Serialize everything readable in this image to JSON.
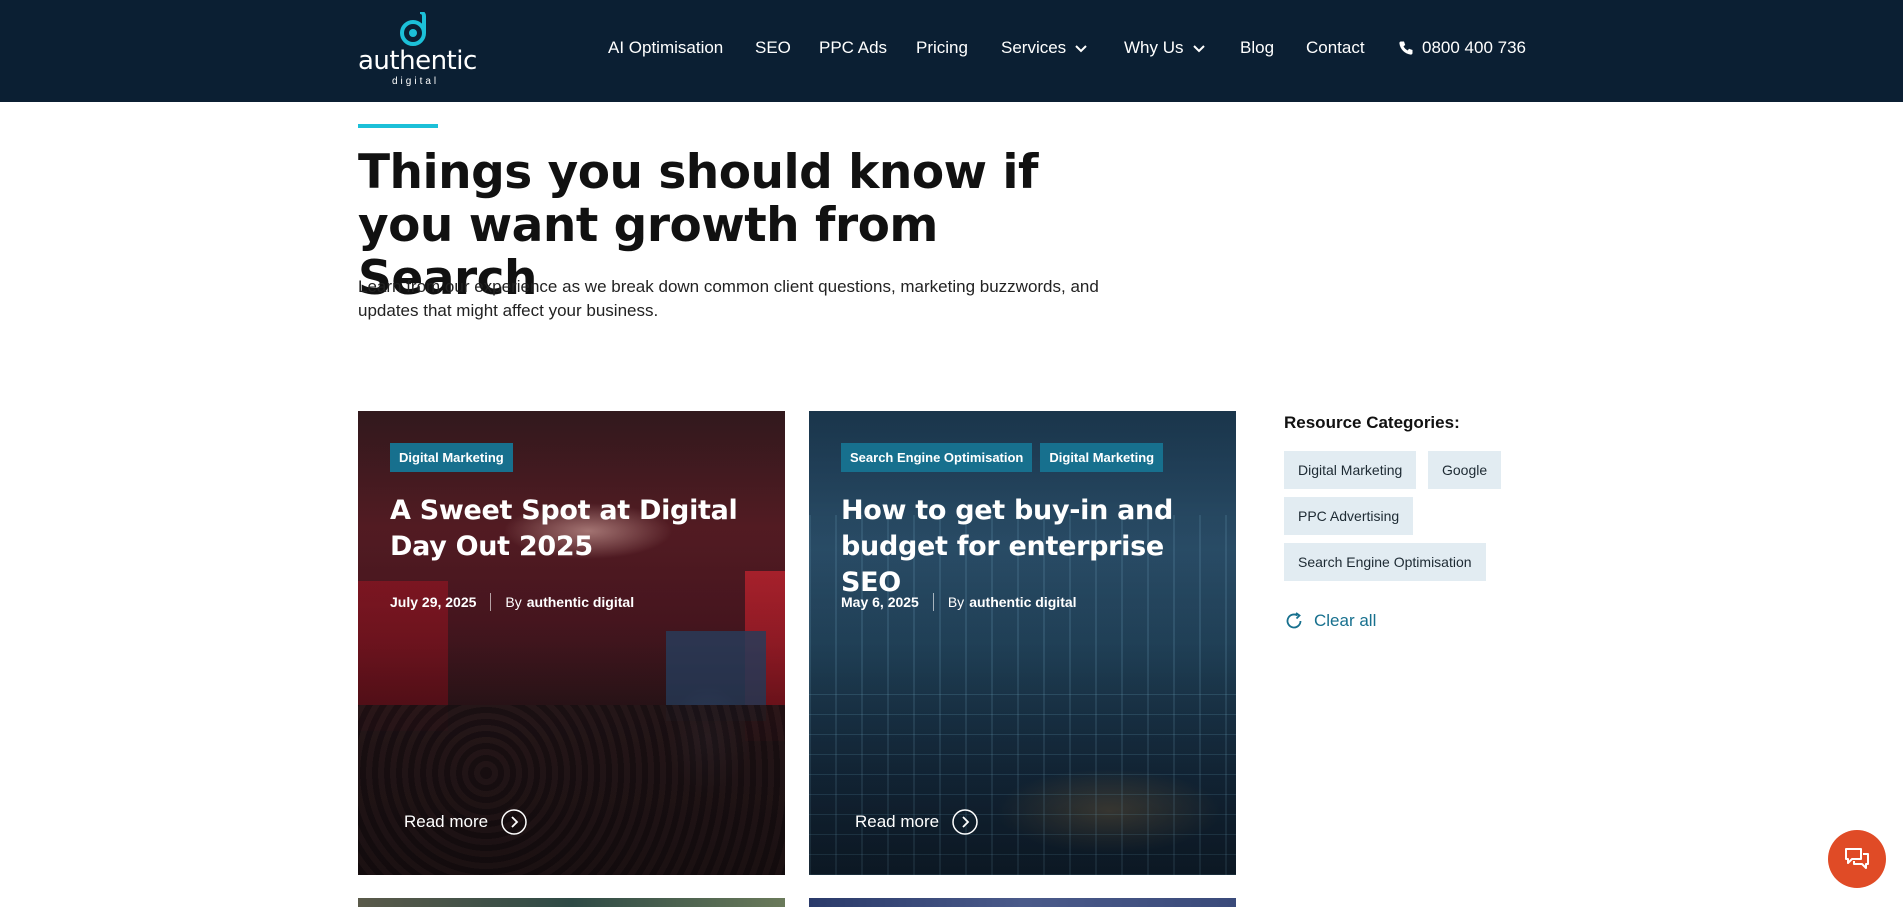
{
  "header": {
    "logo": {
      "word": "authentic",
      "sub": "digital"
    },
    "nav": [
      {
        "label": "AI Optimisation"
      },
      {
        "label": "SEO"
      },
      {
        "label": "PPC Ads"
      },
      {
        "label": "Pricing"
      },
      {
        "label": "Services",
        "dropdown": true
      },
      {
        "label": "Why Us",
        "dropdown": true
      },
      {
        "label": "Blog"
      },
      {
        "label": "Contact"
      }
    ],
    "phone": "0800 400 736"
  },
  "hero": {
    "title": "Things you should know if you want growth from Search",
    "subtitle": "Learn from our experience as we break down common client questions, marketing buzzwords, and updates that might affect your business."
  },
  "cards": [
    {
      "tags": [
        "Digital Marketing"
      ],
      "title": "A Sweet Spot at Digital Day Out 2025",
      "date": "July 29, 2025",
      "by": "By",
      "author": "authentic digital",
      "read_more": "Read more"
    },
    {
      "tags": [
        "Search Engine Optimisation",
        "Digital Marketing"
      ],
      "title": "How to get buy-in and budget for enterprise SEO",
      "date": "May 6, 2025",
      "by": "By",
      "author": "authentic digital",
      "read_more": "Read more"
    }
  ],
  "sidebar": {
    "title": "Resource Categories:",
    "categories": [
      "Digital Marketing",
      "Google",
      "PPC Advertising",
      "Search Engine Optimisation"
    ],
    "clear_label": "Clear all"
  },
  "colors": {
    "header_bg": "#0b1f33",
    "accent": "#1cc0d8",
    "tag_bg": "#17708e",
    "chip_bg": "#e2ecf2",
    "chat_bg": "#e04b26"
  },
  "icons": {
    "dropdown": "chevron-down-icon",
    "phone": "phone-icon",
    "read_more": "chevron-right-circle-icon",
    "clear": "refresh-icon",
    "chat": "chat-bubbles-icon"
  }
}
